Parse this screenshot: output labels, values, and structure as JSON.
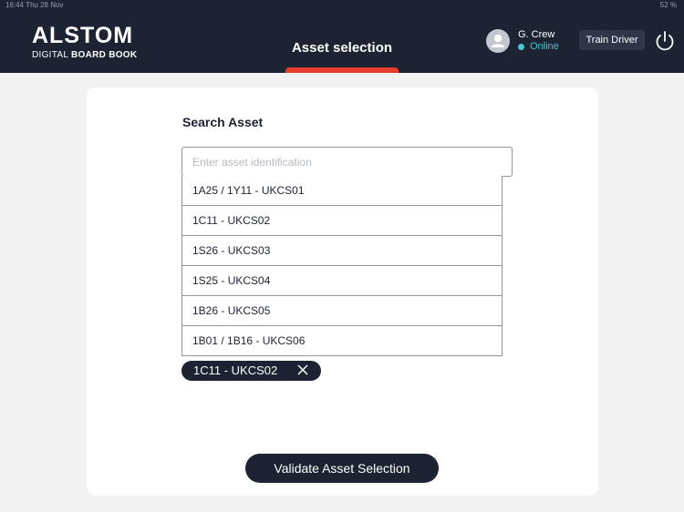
{
  "status_bar": {
    "time_date": "16:44  Thu 28 Nov",
    "battery": "52 %"
  },
  "header": {
    "logo_brand": "ALSTOM",
    "logo_sub_light": "DIGITAL ",
    "logo_sub_bold": "BOARD BOOK",
    "title": "Asset selection",
    "user_name": "G. Crew",
    "user_status": "Online",
    "role": "Train Driver",
    "active_tab_color": "#e63c2e"
  },
  "search": {
    "label": "Search Asset",
    "placeholder": "Enter asset identification",
    "value": "",
    "options": [
      "1A25 / 1Y11 - UKCS01",
      "1C11 - UKCS02",
      "1S26 - UKCS03",
      "1S25 - UKCS04",
      "1B26 - UKCS05",
      "1B01 / 1B16 - UKCS06"
    ]
  },
  "selected": {
    "chip_label": "1C11 - UKCS02"
  },
  "actions": {
    "validate_label": "Validate Asset Selection"
  },
  "colors": {
    "navy": "#1c2333",
    "accent_red": "#e63c2e",
    "online_teal": "#4fc3d0"
  }
}
